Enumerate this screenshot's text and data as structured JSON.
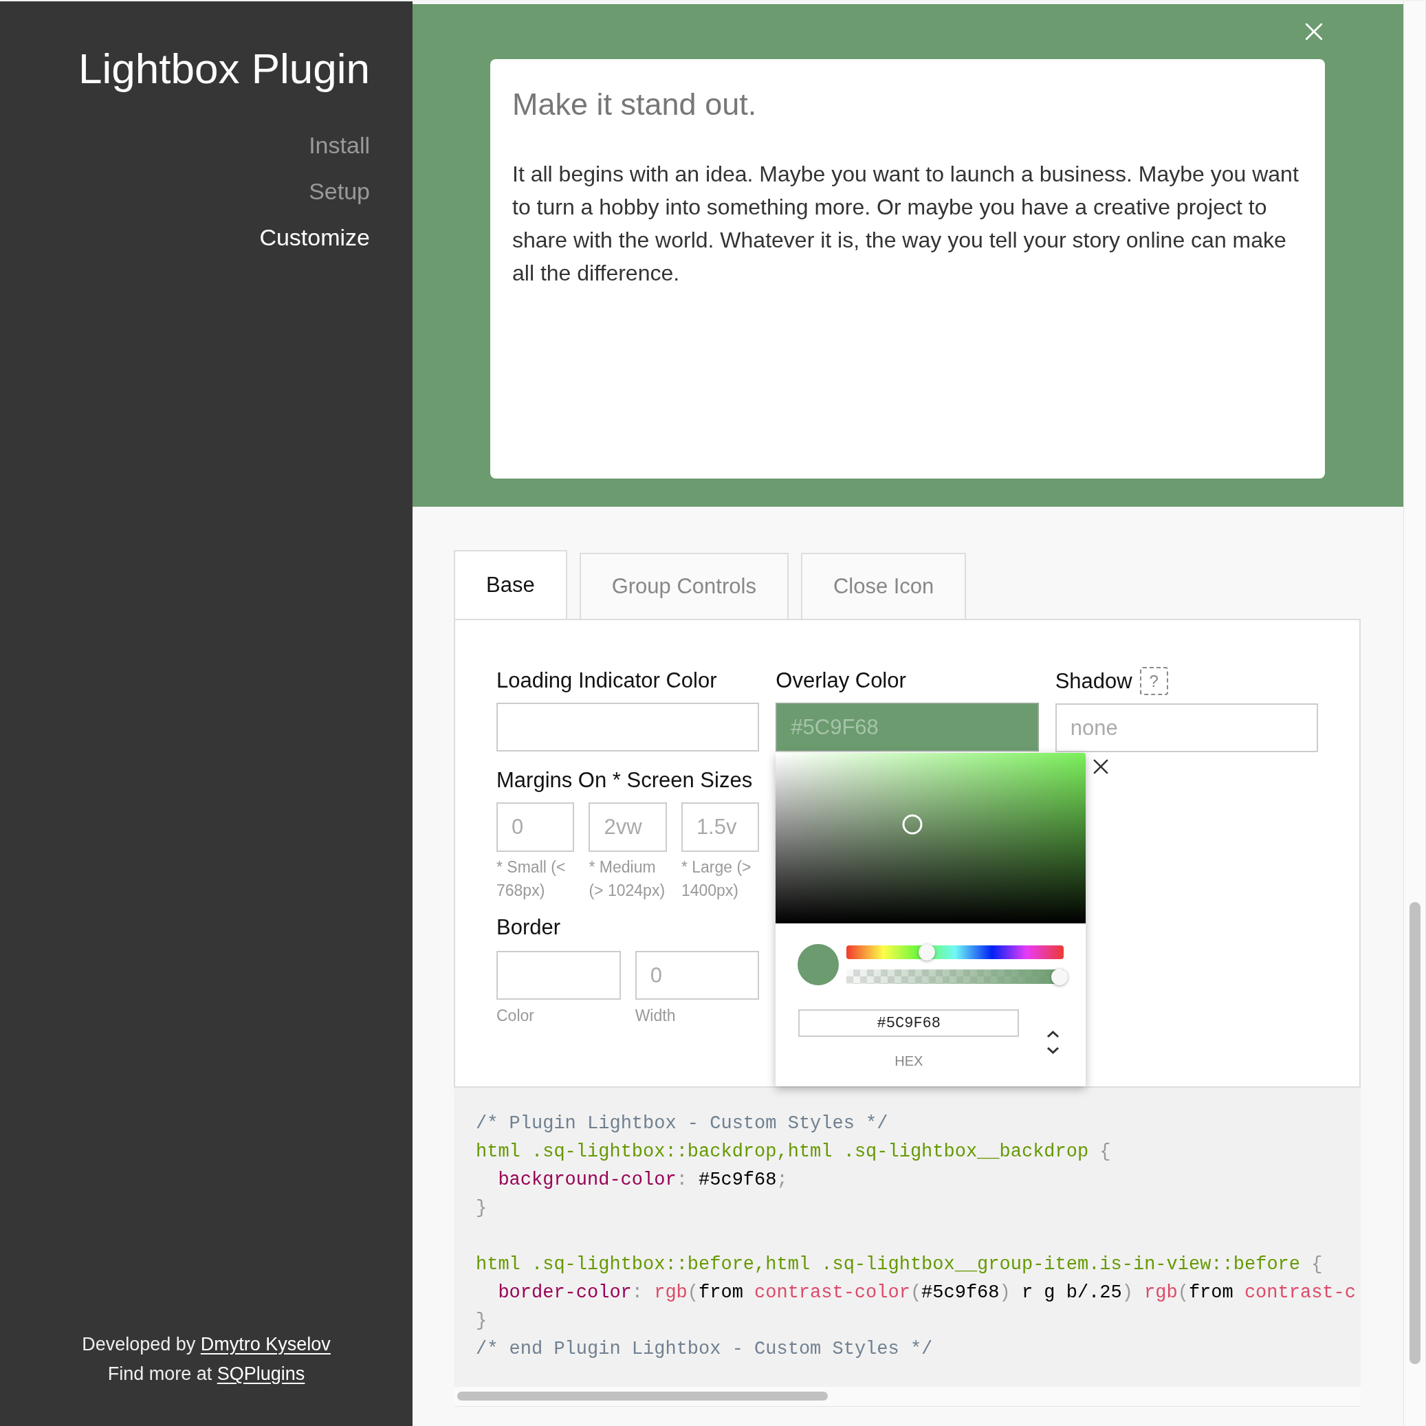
{
  "sidebar": {
    "title": "Lightbox Plugin",
    "nav": [
      {
        "label": "Install",
        "selected": false
      },
      {
        "label": "Setup",
        "selected": false
      },
      {
        "label": "Customize",
        "selected": true
      }
    ],
    "footer": [
      {
        "text": "Developed by",
        "link": "Dmytro Kyselov"
      },
      {
        "text": "Find more at",
        "link": "SQPlugins"
      }
    ]
  },
  "preview": {
    "card": {
      "title": "Make it stand out.",
      "body": "It all begins with an idea. Maybe you want to launch a business. Maybe you want to turn a hobby into something more. Or maybe you have a creative project to share with the world. Whatever it is, the way you tell your story online can make all the difference."
    }
  },
  "tabs": [
    {
      "label": "Base",
      "selected": true
    },
    {
      "label": "Group Controls",
      "selected": false
    },
    {
      "label": "Close Icon",
      "selected": false
    }
  ],
  "form": {
    "loading_indicator_color": {
      "label": "Loading Indicator Color"
    },
    "overlay_color": {
      "label": "Overlay Color",
      "value": "#5C9F68"
    },
    "shadow": {
      "label": "Shadow",
      "help": "?",
      "placeholder": "none"
    },
    "margins": {
      "label": "Margins On * Screen Sizes",
      "fields": [
        {
          "placeholder": "0",
          "hint": "* Small (< 768px)"
        },
        {
          "placeholder": "2vw",
          "hint": "* Medium (> 1024px)"
        },
        {
          "placeholder": "1.5v",
          "hint": "* Large (> 1400px)"
        }
      ]
    },
    "border": {
      "label": "Border",
      "fields": [
        {
          "hint": "Color"
        },
        {
          "placeholder": "0",
          "hint": "Width"
        }
      ]
    }
  },
  "color_picker": {
    "hue": {
      "level": 0.35
    },
    "alpha": {
      "level": 1
    },
    "hex": "#5C9F68",
    "format": "HEX"
  },
  "code": {
    "blocks": [
      {
        "lines": [
          {
            "indented": false,
            "words": [
              [
                {
                  "kind": "comment",
                  "text": "/* Plugin Lightbox - Custom Styles */"
                }
              ]
            ]
          },
          {
            "indented": false,
            "words": [
              [
                {
                  "kind": "selector",
                  "text": "html .sq-lightbox::backdrop,html .sq-lightbox__backdrop"
                }
              ],
              [
                {
                  "kind": "punctuation",
                  "text": "{"
                }
              ]
            ]
          },
          {
            "indented": true,
            "words": [
              [
                {
                  "kind": "property",
                  "text": "background-color"
                },
                {
                  "kind": "punctuation",
                  "text": ":"
                }
              ],
              [
                {
                  "kind": "value",
                  "text": "#5c9f68"
                },
                {
                  "kind": "punctuation",
                  "text": ";"
                }
              ]
            ]
          },
          {
            "indented": false,
            "words": [
              [
                {
                  "kind": "punctuation",
                  "text": "}"
                }
              ]
            ]
          }
        ]
      },
      {
        "lines": [
          {
            "indented": false,
            "words": [
              [
                {
                  "kind": "selector",
                  "text": "html .sq-lightbox::before,html .sq-lightbox__group-item.is-in-view::before"
                }
              ],
              [
                {
                  "kind": "punctuation",
                  "text": "{"
                }
              ]
            ]
          },
          {
            "indented": true,
            "words": [
              [
                {
                  "kind": "property",
                  "text": "border-color"
                },
                {
                  "kind": "punctuation",
                  "text": ":"
                }
              ],
              [
                {
                  "kind": "function",
                  "text": "rgb"
                },
                {
                  "kind": "punctuation",
                  "text": "("
                },
                {
                  "kind": "value",
                  "text": "from"
                }
              ],
              [
                {
                  "kind": "function",
                  "text": "contrast-color"
                },
                {
                  "kind": "punctuation",
                  "text": "("
                },
                {
                  "kind": "value",
                  "text": "#5c9f68"
                },
                {
                  "kind": "punctuation",
                  "text": ")"
                }
              ],
              [
                {
                  "kind": "value",
                  "text": "r g b/.25"
                },
                {
                  "kind": "punctuation",
                  "text": ")"
                }
              ],
              [
                {
                  "kind": "function",
                  "text": "rgb"
                },
                {
                  "kind": "punctuation",
                  "text": "("
                },
                {
                  "kind": "value",
                  "text": "from"
                }
              ],
              [
                {
                  "kind": "function",
                  "text": "contrast-c"
                }
              ]
            ]
          },
          {
            "indented": false,
            "words": [
              [
                {
                  "kind": "punctuation",
                  "text": "}"
                }
              ]
            ]
          },
          {
            "indented": false,
            "words": [
              [
                {
                  "kind": "comment",
                  "text": "/* end Plugin Lightbox - Custom Styles */"
                }
              ]
            ]
          }
        ]
      }
    ]
  }
}
